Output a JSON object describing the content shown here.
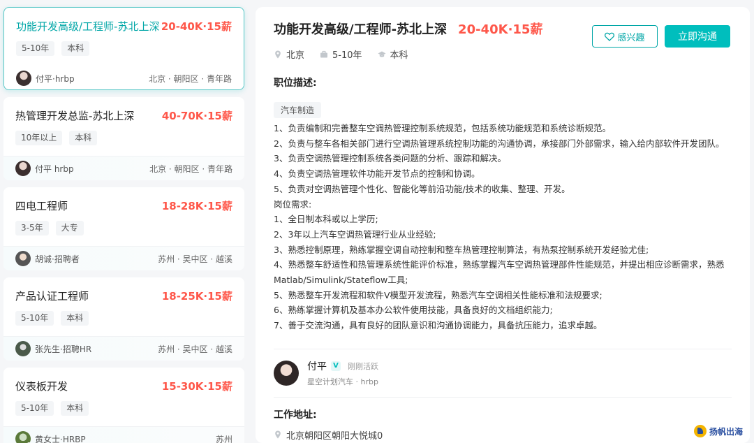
{
  "job_list": [
    {
      "title": "功能开发高级/工程师-苏北上深",
      "salary": "20-40K·15薪",
      "tags": [
        "5-10年",
        "本科"
      ],
      "recruiter": "付平·hrbp",
      "location": "北京 · 朝阳区 · 青年路",
      "active": true
    },
    {
      "title": "热管理开发总监-苏北上深",
      "salary": "40-70K·15薪",
      "tags": [
        "10年以上",
        "本科"
      ],
      "recruiter": "付平 hrbp",
      "location": "北京 · 朝阳区 · 青年路"
    },
    {
      "title": "四电工程师",
      "salary": "18-28K·15薪",
      "tags": [
        "3-5年",
        "大专"
      ],
      "recruiter": "胡诚·招聘者",
      "location": "苏州 · 吴中区 · 越溪"
    },
    {
      "title": "产品认证工程师",
      "salary": "18-25K·15薪",
      "tags": [
        "5-10年",
        "本科"
      ],
      "recruiter": "张先生·招聘HR",
      "location": "苏州 · 吴中区 · 越溪"
    },
    {
      "title": "仪表板开发",
      "salary": "15-30K·15薪",
      "tags": [
        "5-10年",
        "本科"
      ],
      "recruiter": "黄女士·HRBP",
      "location": "苏州"
    }
  ],
  "detail": {
    "title": "功能开发高级/工程师-苏北上深",
    "salary": "20-40K·15薪",
    "city": "北京",
    "experience": "5-10年",
    "degree": "本科",
    "interest_label": "感兴趣",
    "chat_label": "立即沟通",
    "section_title": "职位描述:",
    "industry_tag": "汽车制造",
    "description": [
      "1、负责编制和完善整车空调热管理控制系统规范，包括系统功能规范和系统诊断规范。",
      "2、负责与整车各相关部门进行空调热管理系统控制功能的沟通协调，承接部门外部需求，输入给内部软件开发团队。",
      "3、负责空调热管理控制系统各类问题的分析、跟踪和解决。",
      "4、负责空调热管理软件功能开发节点的控制和协调。",
      "5、负责对空调热管理个性化、智能化等前沿功能/技术的收集、整理、开发。",
      "岗位需求:",
      "1、全日制本科或以上学历;",
      "2、3年以上汽车空调热管理行业从业经验;",
      "3、熟悉控制原理，熟练掌握空调自动控制和整车热管理控制算法，有热泵控制系统开发经验尤佳;",
      "4、熟悉整车舒适性和热管理系统性能评价标准，熟练掌握汽车空调热管理部件性能规范，并提出相应诊断需求，熟悉Matlab/Simulink/Stateflow工具;",
      "5、熟悉整车开发流程和软件V模型开发流程，熟悉汽车空调相关性能标准和法规要求;",
      "6、熟练掌握计算机及基本办公软件使用技能，具备良好的文档组织能力;",
      "7、善于交流沟通，具有良好的团队意识和沟通协调能力，具备抗压能力，追求卓越。"
    ],
    "hr": {
      "name": "付平",
      "verified_mark": "V",
      "active_status": "刚刚活跃",
      "company_role": "星空计划汽车 · hrbp"
    },
    "address_title": "工作地址:",
    "address": "北京朝阳区朝阳大悦城0"
  },
  "watermark": "扬帆出海",
  "colors": {
    "accent": "#00bebd",
    "salary": "#fe574a",
    "active_border": "#55c6c5"
  }
}
